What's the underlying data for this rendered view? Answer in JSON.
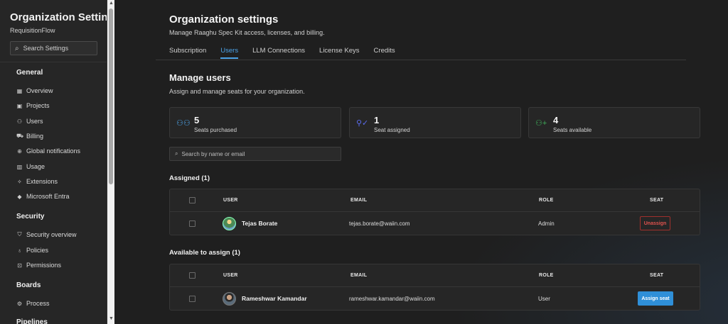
{
  "sidebar": {
    "org_title": "Organization Settin...",
    "org_subtitle": "RequisitionFlow",
    "search_placeholder": "Search Settings",
    "sections": {
      "general": "General",
      "security": "Security",
      "boards": "Boards",
      "pipelines": "Pipelines"
    },
    "general_items": [
      "Overview",
      "Projects",
      "Users",
      "Billing",
      "Global notifications",
      "Usage",
      "Extensions",
      "Microsoft Entra"
    ],
    "security_items": [
      "Security overview",
      "Policies",
      "Permissions"
    ],
    "boards_items": [
      "Process"
    ]
  },
  "header": {
    "title": "Organization settings",
    "description": "Manage Raaghu Spec Kit access, licenses, and billing.",
    "tabs": [
      "Subscription",
      "Users",
      "LLM Connections",
      "License Keys",
      "Credits"
    ],
    "active_tab": "Users"
  },
  "manage": {
    "title": "Manage users",
    "description": "Assign and manage seats for your organization."
  },
  "stats": [
    {
      "value": "5",
      "label": "Seats purchased",
      "color": "#4da3e8"
    },
    {
      "value": "1",
      "label": "Seat assigned",
      "color": "#5b6cf0"
    },
    {
      "value": "4",
      "label": "Seats available",
      "color": "#3fae5a"
    }
  ],
  "user_search_placeholder": "Search by name or email",
  "columns": {
    "user": "USER",
    "email": "EMAIL",
    "role": "ROLE",
    "seat": "SEAT"
  },
  "assigned": {
    "title": "Assigned (1)",
    "rows": [
      {
        "name": "Tejas Borate",
        "email": "tejas.borate@waiin.com",
        "role": "Admin",
        "action": "Unassign"
      }
    ]
  },
  "available": {
    "title": "Available to assign (1)",
    "rows": [
      {
        "name": "Rameshwar Kamandar",
        "email": "rameshwar.kamandar@waiin.com",
        "role": "User",
        "action": "Assign seat"
      }
    ]
  }
}
